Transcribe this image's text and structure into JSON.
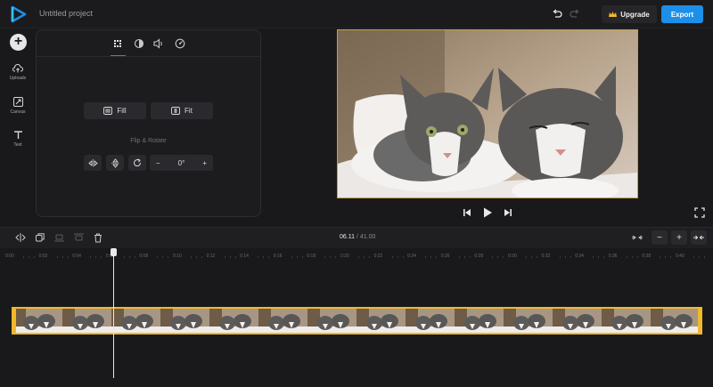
{
  "app": {
    "project_title": "Untitled project",
    "upgrade_label": "Upgrade",
    "export_label": "Export",
    "accent_color": "#1c8fe8",
    "highlight_color": "#f0b92a"
  },
  "rail": {
    "items": [
      {
        "label": "Uploads",
        "icon": "cloud-upload-icon"
      },
      {
        "label": "Canvas",
        "icon": "canvas-resize-icon"
      },
      {
        "label": "Text",
        "icon": "text-icon"
      }
    ]
  },
  "panel": {
    "tabs": [
      "grid-tab-icon",
      "contrast-tab-icon",
      "volume-tab-icon",
      "speed-tab-icon"
    ],
    "fill_label": "Fill",
    "fit_label": "Fit",
    "flip_rotate_label": "Flip & Rotate",
    "rotation_value": "0°"
  },
  "timeline": {
    "current_time": "06.11",
    "separator": "/",
    "total_time": "41.00",
    "ruler_labels": [
      "0:00",
      "0:02",
      "0:04",
      "0:06",
      "0:08",
      "0:10",
      "0:12",
      "0:14",
      "0:16",
      "0:18",
      "0:20",
      "0:22",
      "0:24",
      "0:26",
      "0:28",
      "0:30",
      "0:32",
      "0:34",
      "0:36",
      "0:38",
      "0:40"
    ]
  }
}
